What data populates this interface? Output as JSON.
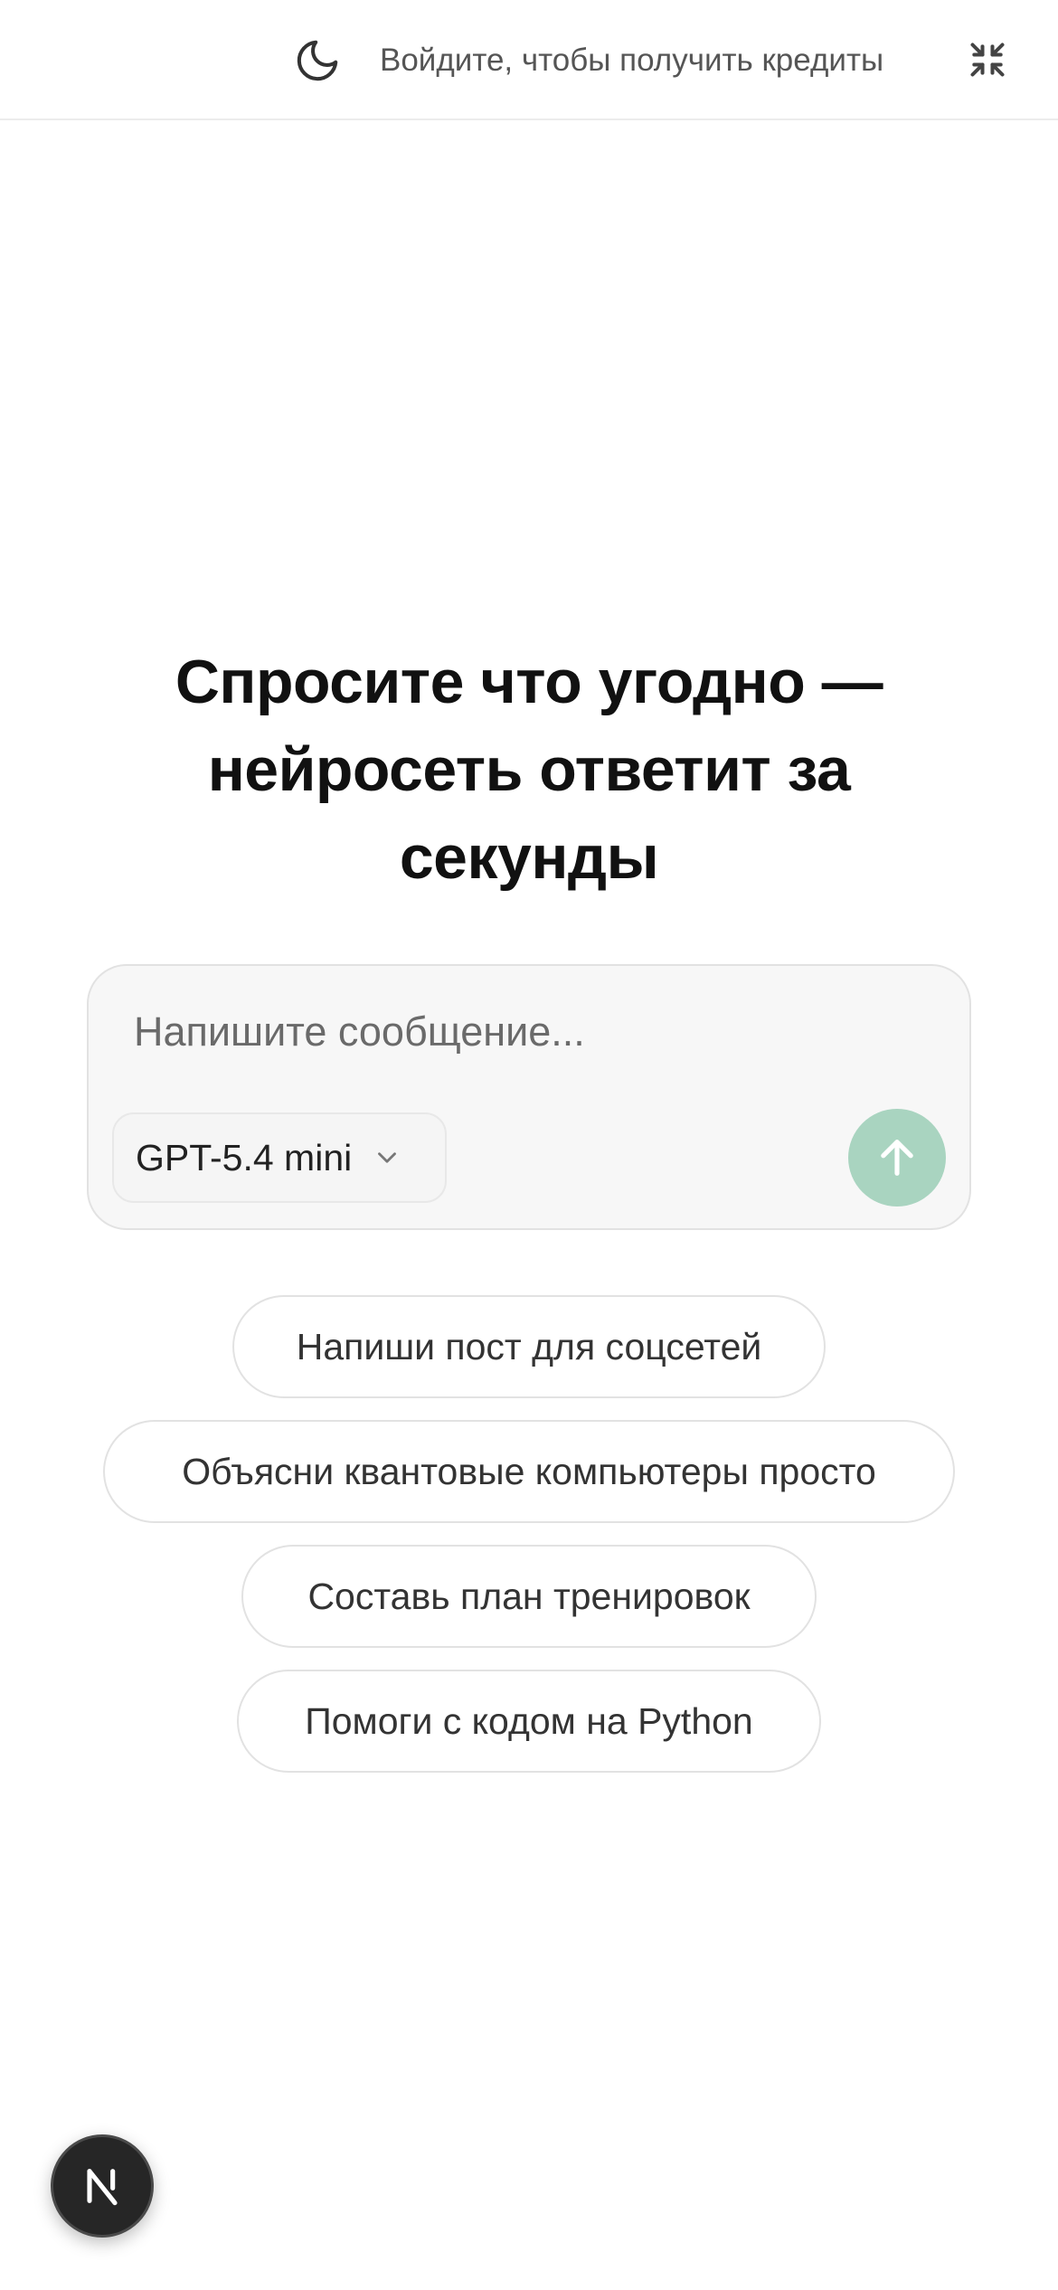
{
  "header": {
    "login_text": "Войдите, чтобы получить кредиты",
    "theme_icon": "moon-icon",
    "collapse_icon": "collapse-icon"
  },
  "hero": {
    "title": "Спросите что угодно — нейросеть ответит за секунды"
  },
  "composer": {
    "placeholder": "Напишите сообщение...",
    "value": "",
    "model": {
      "selected": "GPT-5.4 mini",
      "icon": "chevron-down-icon"
    },
    "send_icon": "arrow-up-icon",
    "send_color": "#a9d4c0"
  },
  "suggestions": [
    {
      "label": "Напиши пост для соцсетей"
    },
    {
      "label": "Объясни квантовые компьютеры просто"
    },
    {
      "label": "Составь план тренировок"
    },
    {
      "label": "Помоги с кодом на Python"
    }
  ],
  "badge": {
    "icon": "n-logo-icon"
  }
}
